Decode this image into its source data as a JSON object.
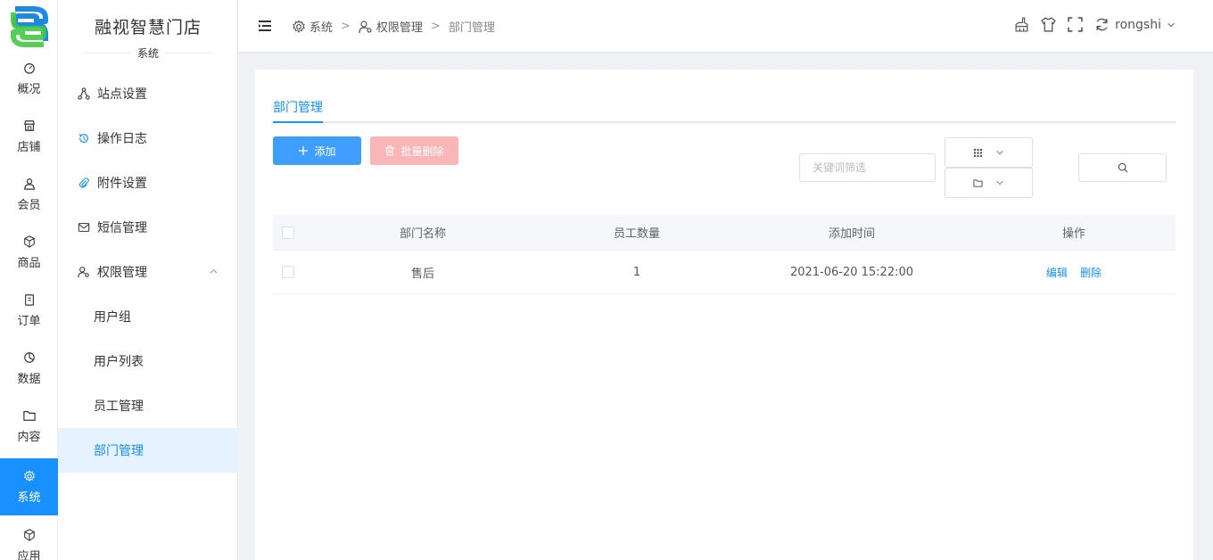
{
  "brand": {
    "name": "融视智慧门店",
    "section_caption": "系统"
  },
  "rail": [
    {
      "label": "概况",
      "icon": "dashboard-icon"
    },
    {
      "label": "店铺",
      "icon": "shop-icon"
    },
    {
      "label": "会员",
      "icon": "user-icon"
    },
    {
      "label": "商品",
      "icon": "box-icon"
    },
    {
      "label": "订单",
      "icon": "clipboard-icon"
    },
    {
      "label": "数据",
      "icon": "pie-chart-icon"
    },
    {
      "label": "内容",
      "icon": "folder-icon"
    },
    {
      "label": "系统",
      "icon": "gear-icon",
      "active": true
    },
    {
      "label": "应用",
      "icon": "cube-icon"
    }
  ],
  "submenu": {
    "items": [
      "站点设置",
      "操作日志",
      "附件设置",
      "短信管理",
      "权限管理"
    ],
    "children": [
      "用户组",
      "用户列表",
      "员工管理",
      "部门管理"
    ],
    "active_child": "部门管理"
  },
  "header": {
    "breadcrumb": [
      "系统",
      "权限管理",
      "部门管理"
    ],
    "username": "rongshi"
  },
  "page": {
    "tab": "部门管理",
    "add_label": "添加",
    "batch_delete_label": "批量删除",
    "keyword_placeholder": "关键词筛选"
  },
  "table": {
    "columns": [
      "部门名称",
      "员工数量",
      "添加时间",
      "操作"
    ],
    "rows": [
      {
        "name": "售后",
        "count": "1",
        "time": "2021-06-20 15:22:00",
        "edit": "编辑",
        "delete": "删除"
      }
    ]
  },
  "colors": {
    "primary": "#1890ff",
    "danger_light": "#fab6b6",
    "add_button": "#409eff"
  }
}
